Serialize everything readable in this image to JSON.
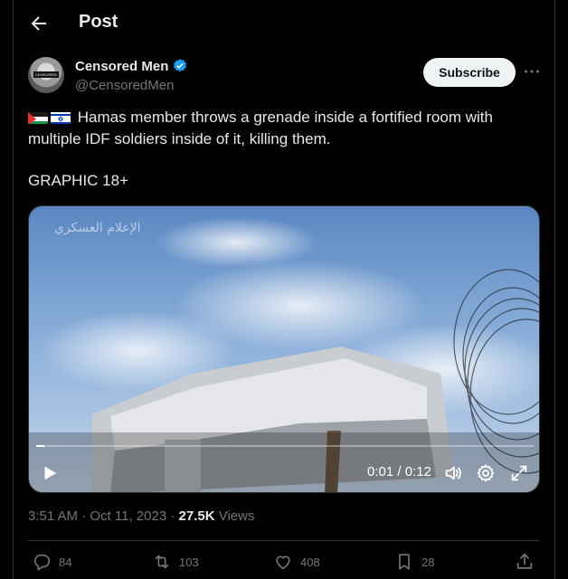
{
  "header": {
    "title": "Post"
  },
  "author": {
    "display_name": "Censored Men",
    "handle": "@CensoredMen",
    "avatar_band_text": "CENSORED"
  },
  "subscribe_label": "Subscribe",
  "tweet": {
    "text": "Hamas member throws a grenade inside a fortified room with multiple IDF soldiers inside of it, killing them.",
    "line2": "GRAPHIC 18+",
    "flags": [
      "palestine-flag-icon",
      "israel-flag-icon"
    ]
  },
  "video": {
    "watermark": "الإعلام العسكري",
    "time_display": "0:01 / 0:12",
    "progress": 0.0167
  },
  "meta": {
    "time": "3:51 AM",
    "separator": "·",
    "date": "Oct 11, 2023",
    "views_count": "27.5K",
    "views_label": "Views"
  },
  "actions": {
    "replies": "84",
    "reposts": "103",
    "likes": "408",
    "bookmarks": "28"
  },
  "colors": {
    "background": "#000000",
    "text": "#e7e9ea",
    "muted": "#71767b",
    "border": "#2f3336",
    "verified": "#1d9bf0"
  }
}
